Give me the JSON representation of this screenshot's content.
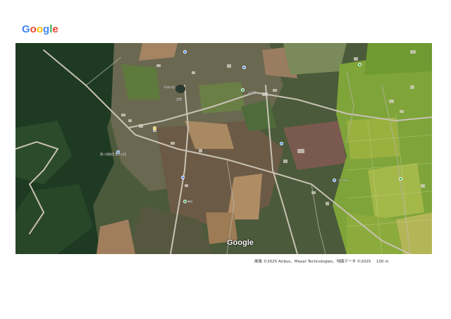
{
  "header": {
    "logo_letters": [
      "G",
      "o",
      "o",
      "g",
      "l",
      "e"
    ],
    "logo_colors": [
      "#4285F4",
      "#EA4335",
      "#FBBC05",
      "#4285F4",
      "#34A853",
      "#EA4335"
    ]
  },
  "map": {
    "view": "satellite",
    "watermark": "Google",
    "pois": [
      {
        "label": "平成の田",
        "color": "#1a73e8"
      },
      {
        "label": "会館",
        "color": "#34a853"
      },
      {
        "label": "公民館",
        "color": "#4285f4"
      },
      {
        "label": "第八消防団 第五分団",
        "color": "#4285f4"
      },
      {
        "label": "神社",
        "color": "#34a853"
      },
      {
        "label": "センター",
        "color": "#4285f4"
      },
      {
        "label": "",
        "color": "#fbbc05"
      },
      {
        "label": "",
        "color": "#34a853"
      },
      {
        "label": "",
        "color": "#4285f4"
      },
      {
        "label": "",
        "color": "#34a853"
      }
    ]
  },
  "footer": {
    "attribution": "画像 ©2025 Airbus、Maxar Technologies、地図データ ©2025",
    "scale": "100 m"
  }
}
